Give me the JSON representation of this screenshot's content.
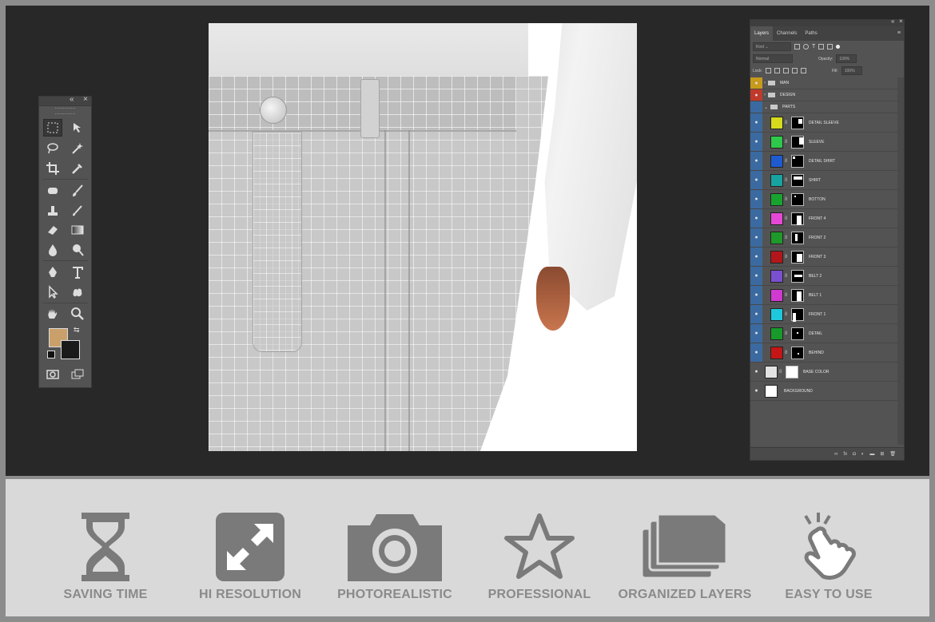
{
  "layers_panel": {
    "tabs": [
      "Layers",
      "Channels",
      "Paths"
    ],
    "active_tab": "Layers",
    "filter": {
      "label": "Kind"
    },
    "blend_mode": "Normal",
    "opacity_label": "Opacity:",
    "opacity_value": "100%",
    "lock_label": "Lock:",
    "fill_label": "Fill:",
    "fill_value": "100%",
    "groups": [
      {
        "name": "MAN",
        "color": "#c79a1b"
      },
      {
        "name": "DESIGN",
        "color": "#c0392b"
      },
      {
        "name": "PARTS",
        "color": "#3b6aa0"
      }
    ],
    "layers": [
      {
        "name": "DETAIL SLEEVE",
        "color": "#d7d91d"
      },
      {
        "name": "SLEEVE",
        "color": "#2ec94a"
      },
      {
        "name": "DETAIL SHIRT",
        "color": "#1f5bd0"
      },
      {
        "name": "SHIRT",
        "color": "#17a3a0"
      },
      {
        "name": "BOTTON",
        "color": "#18a32f"
      },
      {
        "name": "FRONT 4",
        "color": "#e548d6"
      },
      {
        "name": "FRONT 2",
        "color": "#1e9a2a"
      },
      {
        "name": "FRONT 3",
        "color": "#b3161a"
      },
      {
        "name": "BELT 2",
        "color": "#7a4fd0"
      },
      {
        "name": "BELT 1",
        "color": "#d03ad0"
      },
      {
        "name": "FRONT 1",
        "color": "#1ec8dc"
      },
      {
        "name": "DETAIL",
        "color": "#179a2a"
      },
      {
        "name": "BEHIND",
        "color": "#c41616"
      }
    ],
    "base_layers": [
      {
        "name": "BASE COLOR",
        "color": "#e2e2e2"
      },
      {
        "name": "BACKGROUND",
        "color": "#ffffff"
      }
    ]
  },
  "toolbox": {
    "tools": [
      "rectangular-marquee",
      "move",
      "lasso",
      "magic-wand",
      "crop",
      "eyedropper",
      "spot-healing",
      "brush",
      "clone-stamp",
      "history-brush",
      "eraser",
      "gradient",
      "blur",
      "dodge",
      "pen",
      "type",
      "path-selection",
      "custom-shape",
      "hand",
      "zoom"
    ],
    "foreground_color": "#c9a06a",
    "background_color": "#1a1a1a"
  },
  "features": [
    {
      "label": "SAVING TIME",
      "icon": "hourglass-icon"
    },
    {
      "label": "HI RESOLUTION",
      "icon": "expand-icon"
    },
    {
      "label": "PHOTOREALISTIC",
      "icon": "camera-icon"
    },
    {
      "label": "PROFESSIONAL",
      "icon": "star-icon"
    },
    {
      "label": "ORGANIZED LAYERS",
      "icon": "folders-icon"
    },
    {
      "label": "EASY TO USE",
      "icon": "pointing-hand-icon"
    }
  ],
  "colors": {
    "feature_icon": "#7a7a7a",
    "feature_text": "#8a8a8a",
    "panel_bg": "#535353",
    "workspace_bg": "#282828"
  }
}
